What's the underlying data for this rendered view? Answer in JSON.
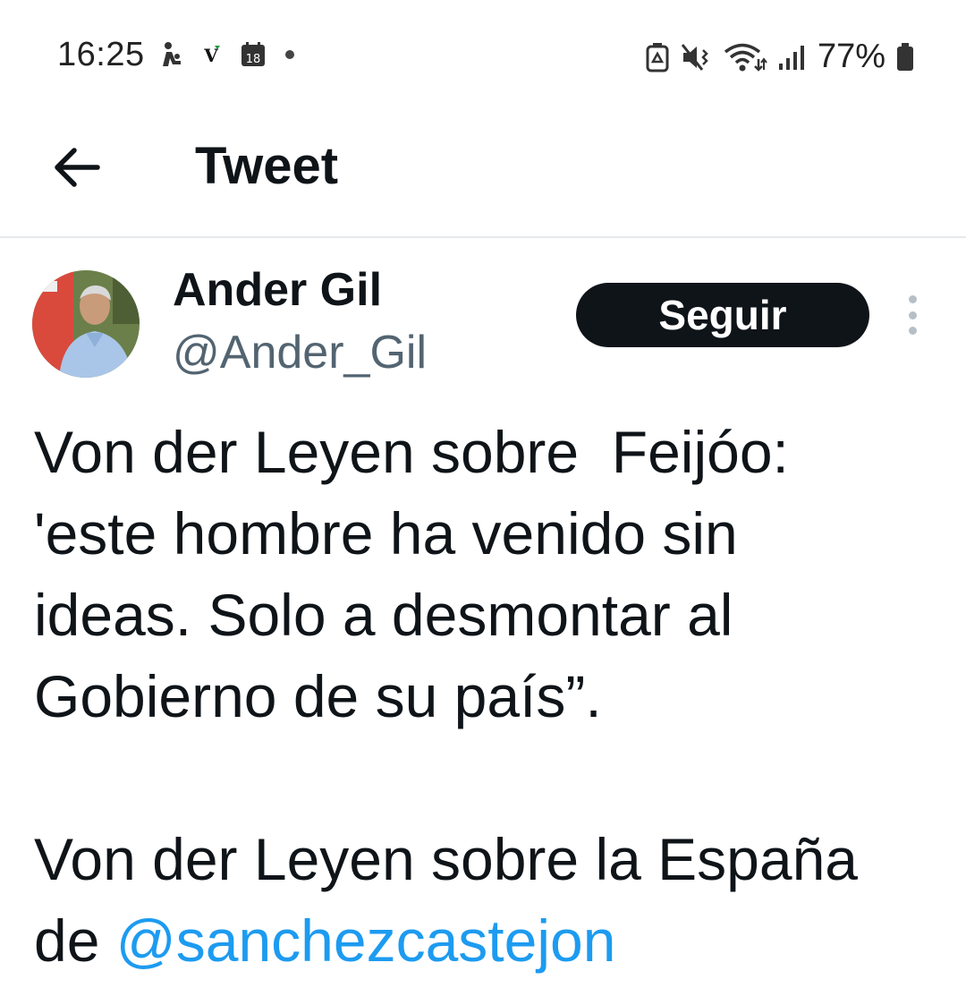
{
  "status_bar": {
    "time": "16:25",
    "calendar_day": "18",
    "vpn_letter": "V",
    "battery_percent": "77%"
  },
  "header": {
    "title": "Tweet"
  },
  "author": {
    "name": "Ander Gil",
    "handle": "@Ander_Gil",
    "follow_label": "Seguir"
  },
  "tweet": {
    "paragraph1": "Von der Leyen sobre  Feijóo:\n'este hombre ha venido sin\nideas. Solo a desmontar al\nGobierno de su país”.",
    "paragraph2_prefix": "Von der Leyen sobre la España\nde ",
    "mention": "@sanchezcastejon"
  },
  "colors": {
    "text": "#0f1419",
    "secondary": "#536471",
    "link": "#1d9bf0",
    "follow_bg": "#0f1419"
  }
}
